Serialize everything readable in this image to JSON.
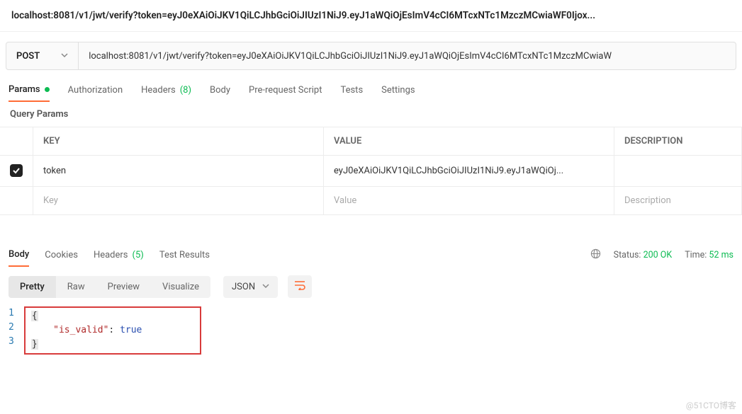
{
  "title": "localhost:8081/v1/jwt/verify?token=eyJ0eXAiOiJKV1QiLCJhbGciOiJIUzI1NiJ9.eyJ1aWQiOjEsImV4cCI6MTcxNTc1MzczMCwiaWF0Ijox...",
  "method": "POST",
  "url": "localhost:8081/v1/jwt/verify?token=eyJ0eXAiOiJKV1QiLCJhbGciOiJIUzI1NiJ9.eyJ1aWQiOjEsImV4cCI6MTcxNTc1MzczMCwiaW",
  "reqTabs": {
    "params": "Params",
    "authorization": "Authorization",
    "headers": "Headers",
    "headersCount": "(8)",
    "body": "Body",
    "prerequest": "Pre-request Script",
    "tests": "Tests",
    "settings": "Settings"
  },
  "subheader": "Query Params",
  "paramsTable": {
    "headers": {
      "key": "KEY",
      "value": "VALUE",
      "description": "DESCRIPTION"
    },
    "rows": [
      {
        "checked": true,
        "key": "token",
        "value": "eyJ0eXAiOiJKV1QiLCJhbGciOiJIUzI1NiJ9.eyJ1aWQiOj..."
      }
    ],
    "placeholders": {
      "key": "Key",
      "value": "Value",
      "description": "Description"
    }
  },
  "respTabs": {
    "body": "Body",
    "cookies": "Cookies",
    "headers": "Headers",
    "headersCount": "(5)",
    "testResults": "Test Results"
  },
  "respMeta": {
    "statusLabel": "Status:",
    "statusValue": "200 OK",
    "timeLabel": "Time:",
    "timeValue": "52 ms"
  },
  "viewModes": {
    "pretty": "Pretty",
    "raw": "Raw",
    "preview": "Preview",
    "visualize": "Visualize"
  },
  "langSelect": "JSON",
  "responseBody": {
    "lines": [
      "1",
      "2",
      "3"
    ],
    "open": "{",
    "key": "\"is_valid\"",
    "colon": ": ",
    "value": "true",
    "close": "}"
  },
  "watermark": "@51CTO博客"
}
